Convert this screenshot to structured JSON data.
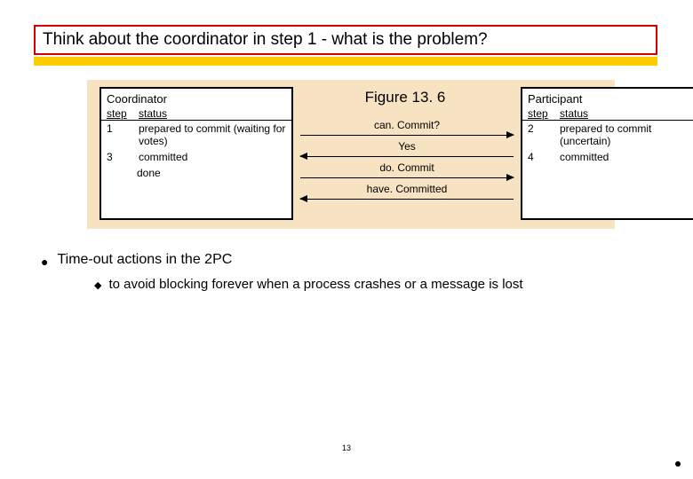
{
  "title": "Think about the coordinator in step 1 - what is the problem?",
  "figure": {
    "label": "Figure 13. 6",
    "coordinator": {
      "title": "Coordinator",
      "col_step": "step",
      "col_status": "status",
      "rows": [
        {
          "step": "1",
          "status": "prepared to commit (waiting for votes)"
        },
        {
          "step": "3",
          "status": "committed"
        }
      ],
      "done": "done"
    },
    "participant": {
      "title": "Participant",
      "col_step": "step",
      "col_status": "status",
      "rows": [
        {
          "step": "2",
          "status": "prepared to commit (uncertain)"
        },
        {
          "step": "4",
          "status": "committed"
        }
      ]
    },
    "messages": {
      "m1": "can. Commit?",
      "m2": "Yes",
      "m3": "do. Commit",
      "m4": "have. Committed"
    }
  },
  "bullets": {
    "b1": "Time-out actions in the 2PC",
    "b2": "to avoid blocking forever when a process crashes or a message is lost"
  },
  "page_number": "13"
}
